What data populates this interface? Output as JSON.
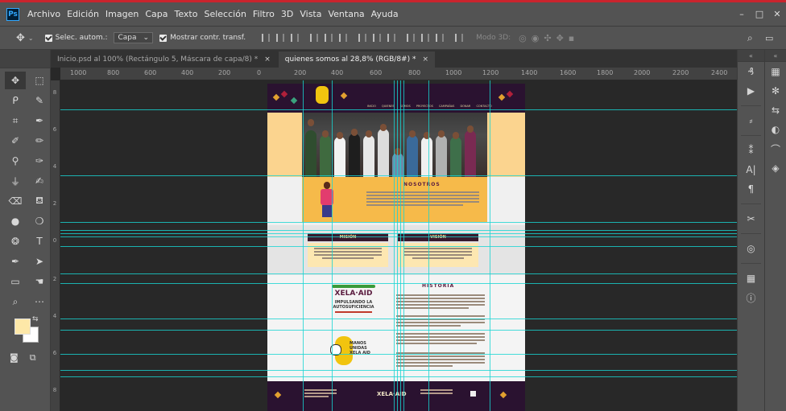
{
  "app": {
    "logo": "Ps"
  },
  "menu": [
    "Archivo",
    "Edición",
    "Imagen",
    "Capa",
    "Texto",
    "Selección",
    "Filtro",
    "3D",
    "Vista",
    "Ventana",
    "Ayuda"
  ],
  "window_controls": {
    "minimize": "–",
    "maximize": "□",
    "close": "✕"
  },
  "options": {
    "auto_select_label": "Selec. autom.:",
    "auto_select_value": "Capa",
    "show_transform_label": "Mostrar contr. transf.",
    "mode3d_label": "Modo 3D:"
  },
  "tabs": [
    {
      "label": "Inicio.psd al 100% (Rectángulo 5, Máscara de capa/8) *",
      "close": "×"
    },
    {
      "label": "quienes somos al 28,8% (RGB/8#) *",
      "close": "×"
    }
  ],
  "ruler_h": [
    "1000",
    "800",
    "600",
    "400",
    "200",
    "0",
    "200",
    "400",
    "600",
    "800",
    "1000",
    "1200",
    "1400",
    "1600",
    "1800",
    "2000",
    "2200",
    "2400"
  ],
  "ruler_v": [
    "8",
    "6",
    "4",
    "2",
    "0",
    "2",
    "4",
    "6",
    "8"
  ],
  "document": {
    "nav": "INICIO QUIENES SOMOS PROYECTOS CAMPAÑAS DONAR CONTACTO",
    "nosotros_title": "NOSOTROS",
    "mision_title": "MISIÓN",
    "vision_title": "VISIÓN",
    "historia_title": "HISTORIA",
    "logo1_name": "XELA·AID",
    "logo1_tag1": "IMPULSANDO LA",
    "logo1_tag2": "AUTOSUFICIENCIA",
    "logo2_line1": "MANOS",
    "logo2_line2": "UNIDAS",
    "logo2_line3": "XELA AID",
    "footer_logo": "XELA·AID"
  }
}
